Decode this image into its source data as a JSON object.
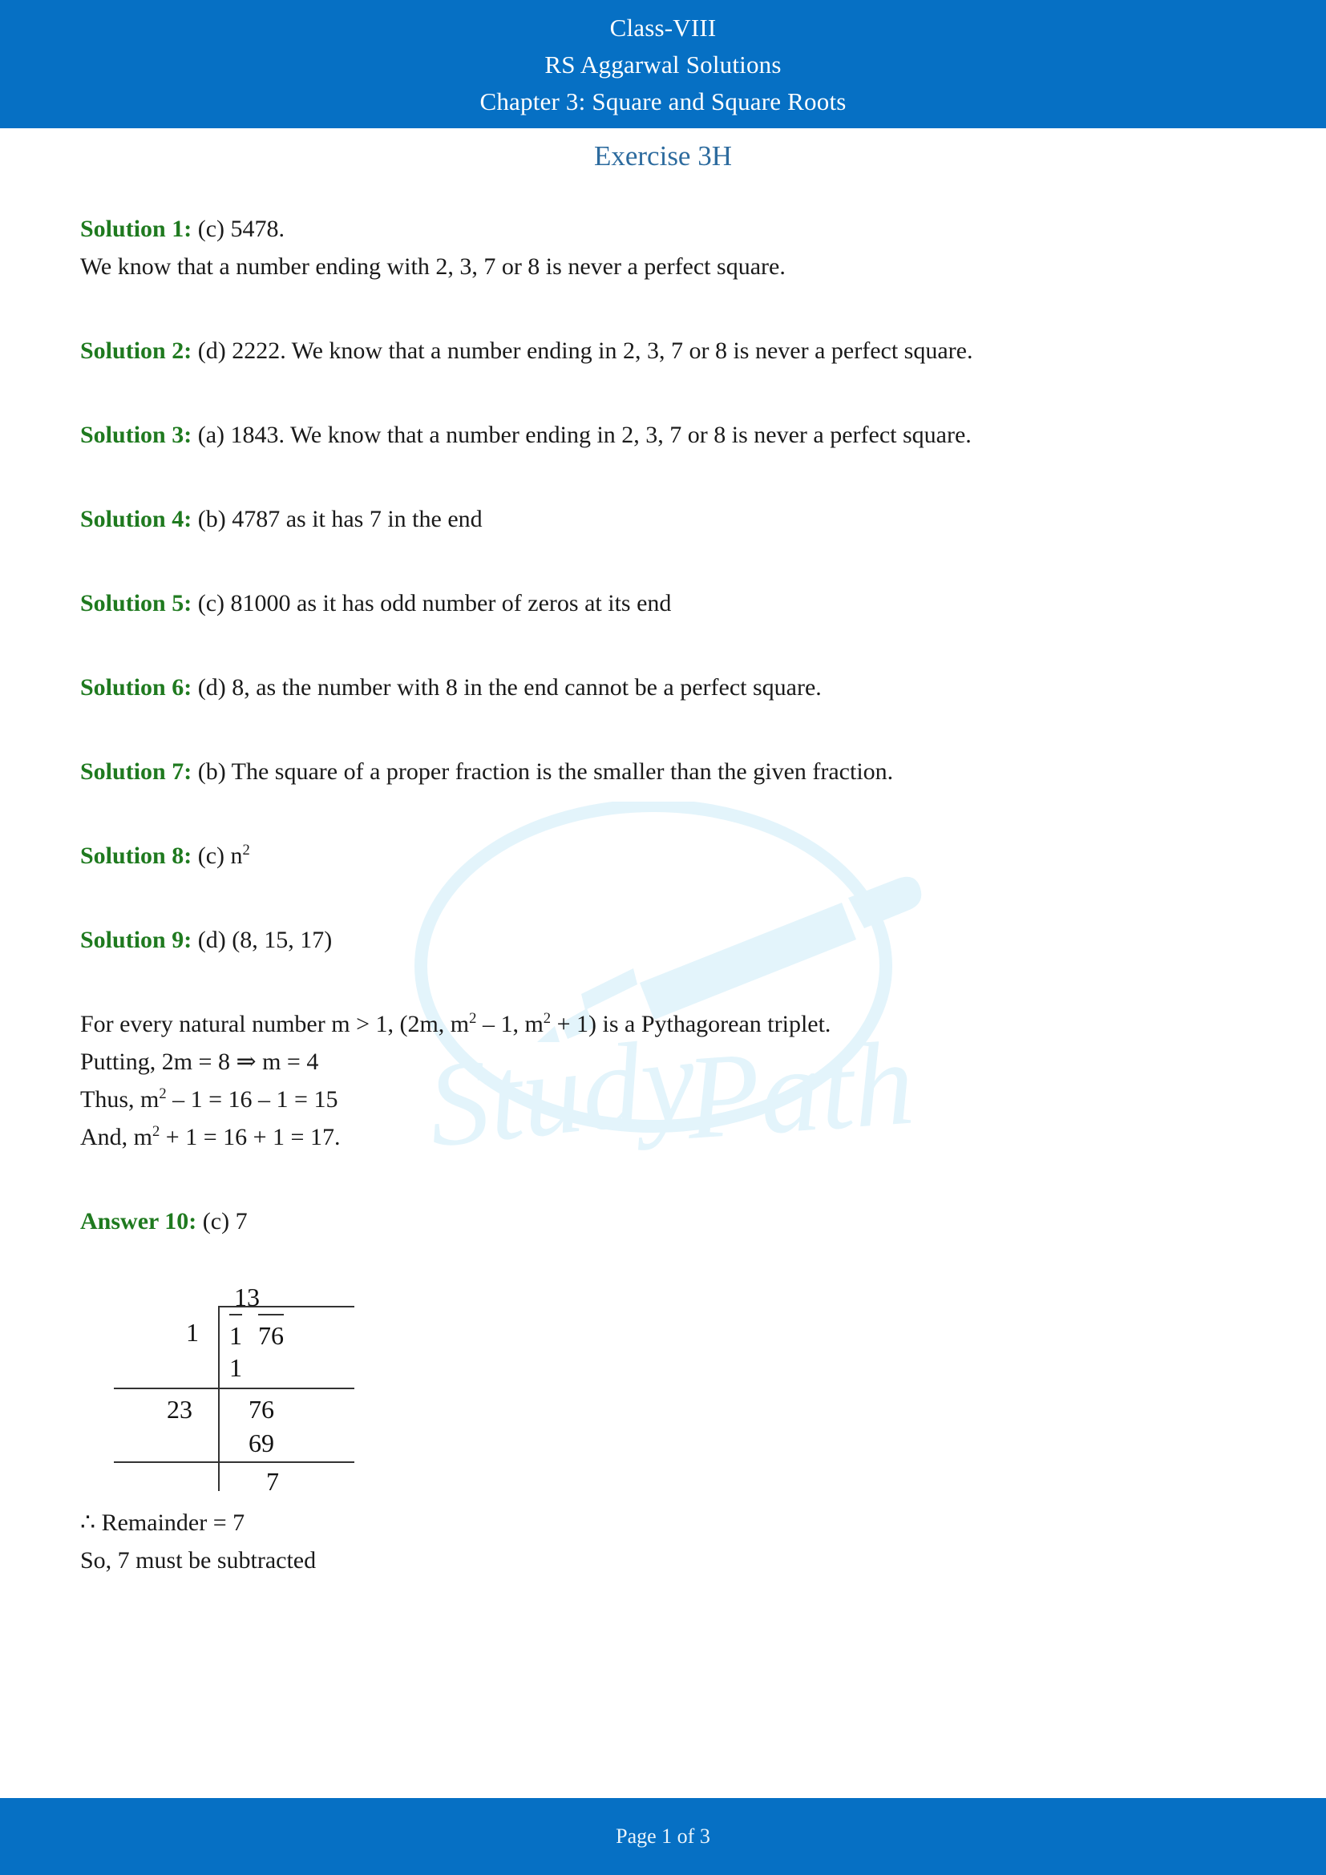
{
  "header": {
    "line1": "Class-VIII",
    "line2": "RS Aggarwal Solutions",
    "line3": "Chapter 3: Square and Square Roots",
    "bar_color": "#0670C4",
    "text_color": "#ffffff"
  },
  "exercise_title": "Exercise 3H",
  "exercise_title_color": "#2D6B9E",
  "label_color": "#1F7A1F",
  "watermark": {
    "brand_text": "Study Path",
    "icon": "fountain-pen-icon",
    "color": "#E3F4FB"
  },
  "solutions": [
    {
      "label": "Solution 1:",
      "answer": " (c) 5478.",
      "explanation": "We know that a number ending with 2, 3, 7 or 8 is never a perfect square."
    },
    {
      "label": "Solution 2:",
      "answer": " (d) 2222. We know that a number ending in 2, 3, 7 or 8 is never a perfect square.",
      "explanation": ""
    },
    {
      "label": "Solution 3:",
      "answer": " (a) 1843. We know that a number ending in 2, 3, 7 or 8 is never a perfect square.",
      "explanation": ""
    },
    {
      "label": "Solution 4:",
      "answer": " (b) 4787 as it has 7 in the end",
      "explanation": ""
    },
    {
      "label": "Solution 5:",
      "answer": " (c) 81000 as it has odd number of zeros at its end",
      "explanation": ""
    },
    {
      "label": "Solution 6:",
      "answer": " (d) 8, as the number with 8 in the end cannot be a perfect square.",
      "explanation": ""
    },
    {
      "label": "Solution 7:",
      "answer": " (b) The square of a proper fraction is the smaller than the given fraction.",
      "explanation": ""
    },
    {
      "label": "Solution 8:",
      "answer_prefix": " (c) n",
      "answer_sup": "2"
    },
    {
      "label": "Solution 9:",
      "answer": " (d) (8, 15, 17)"
    }
  ],
  "pythagorean": {
    "line1_a": "For every natural number m > 1, (2m, m",
    "line1_sup1": "2",
    "line1_b": " – 1, m",
    "line1_sup2": "2",
    "line1_c": " + 1) is a Pythagorean triplet.",
    "line2": "Putting, 2m = 8 ⇒ m = 4",
    "line3_a": "Thus, m",
    "line3_sup": "2",
    "line3_b": " – 1 = 16 – 1 = 15",
    "line4_a": "And, m",
    "line4_sup": "2",
    "line4_b": " + 1 = 16 + 1 = 17."
  },
  "answer10": {
    "label": "Answer 10:",
    "answer": " (c) 7"
  },
  "long_division": {
    "quotient": "13",
    "divisor_step1": "1",
    "dividend_pair1": "1",
    "dividend_pair2": "76",
    "subtract1": "1",
    "divisor_step2": "23",
    "bring_down": "76",
    "subtract2": "69",
    "remainder": "7"
  },
  "conclusion": {
    "line1": "∴ Remainder = 7",
    "line2": "So, 7 must be subtracted"
  },
  "footer": {
    "text": "Page 1 of 3",
    "bar_color": "#0670C4"
  }
}
